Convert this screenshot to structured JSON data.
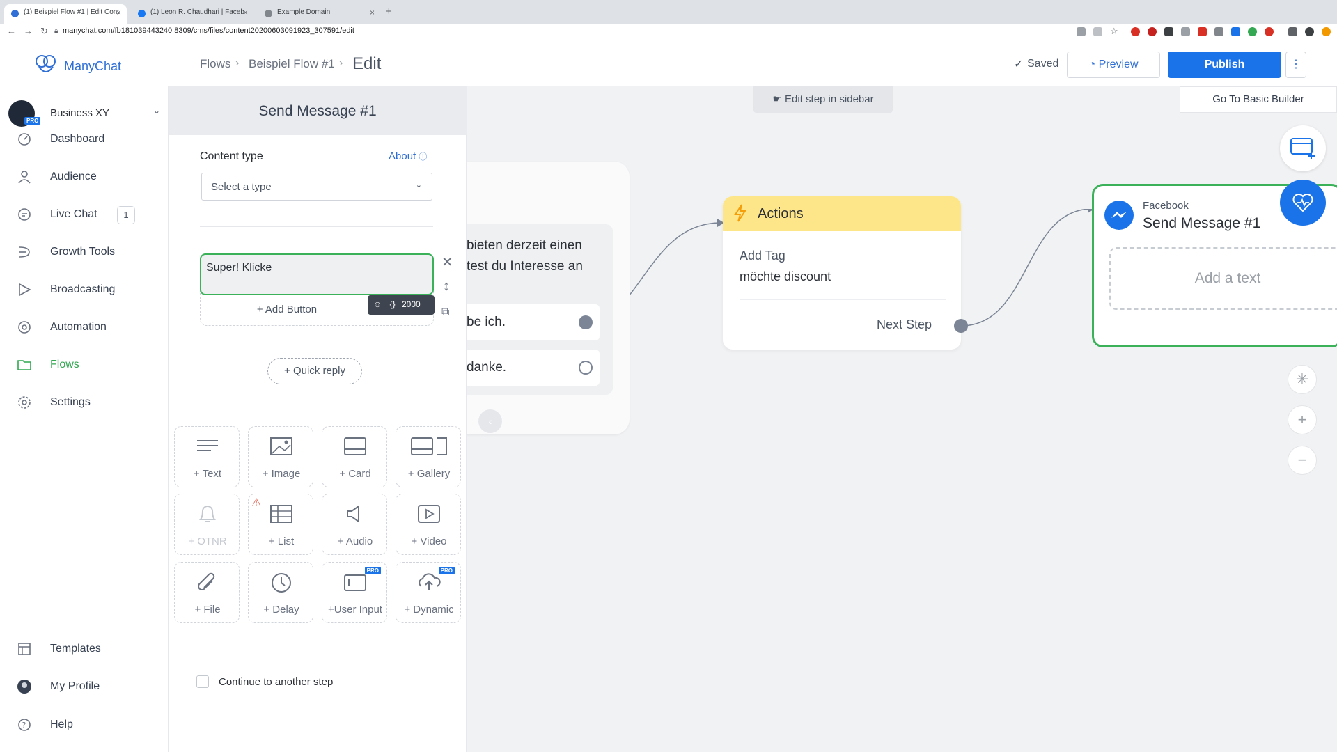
{
  "browser": {
    "tabs": [
      {
        "title": "(1) Beispiel Flow #1 | Edit Cont"
      },
      {
        "title": "(1) Leon R. Chaudhari | Faceb"
      },
      {
        "title": "Example Domain"
      }
    ],
    "url": "manychat.com/fb181039443240 8309/cms/files/content20200603091923_307591/edit"
  },
  "header": {
    "logo": "ManyChat",
    "breadcrumb": [
      "Flows",
      "Beispiel Flow #1"
    ],
    "current": "Edit",
    "saved": "Saved",
    "preview": "Preview",
    "publish": "Publish"
  },
  "sidebar": {
    "business": {
      "name": "Business XY",
      "pro": "PRO"
    },
    "items": [
      {
        "label": "Dashboard",
        "icon": "dashboard-icon"
      },
      {
        "label": "Audience",
        "icon": "audience-icon"
      },
      {
        "label": "Live Chat",
        "icon": "chat-icon",
        "badge": "1"
      },
      {
        "label": "Growth Tools",
        "icon": "growth-tools-icon"
      },
      {
        "label": "Broadcasting",
        "icon": "broadcast-icon"
      },
      {
        "label": "Automation",
        "icon": "automation-icon"
      },
      {
        "label": "Flows",
        "icon": "folder-icon",
        "active": true
      },
      {
        "label": "Settings",
        "icon": "gear-icon"
      }
    ],
    "bottom": [
      {
        "label": "Templates",
        "icon": "templates-icon"
      },
      {
        "label": "My Profile",
        "icon": "avatar-icon"
      },
      {
        "label": "Help",
        "icon": "help-icon"
      }
    ]
  },
  "panel": {
    "title": "Send Message #1",
    "content_type_label": "Content type",
    "about": "About",
    "select_placeholder": "Select a type",
    "text_value": "Super! Klicke",
    "char_limit": "2000",
    "add_button": "+ Add Button",
    "quick_reply": "+ Quick reply",
    "tiles": [
      {
        "label": "+ Text",
        "icon": "text-icon"
      },
      {
        "label": "+ Image",
        "icon": "image-icon"
      },
      {
        "label": "+ Card",
        "icon": "card-icon"
      },
      {
        "label": "+ Gallery",
        "icon": "gallery-icon"
      },
      {
        "label": "+ OTNR",
        "icon": "bell-icon",
        "disabled": true
      },
      {
        "label": "+ List",
        "icon": "list-icon",
        "warning": true
      },
      {
        "label": "+ Audio",
        "icon": "audio-icon"
      },
      {
        "label": "+ Video",
        "icon": "video-icon"
      },
      {
        "label": "+ File",
        "icon": "paperclip-icon"
      },
      {
        "label": "+ Delay",
        "icon": "clock-icon"
      },
      {
        "label": "+User Input",
        "icon": "user-input-icon",
        "pro": "PRO"
      },
      {
        "label": "+ Dynamic",
        "icon": "dynamic-icon",
        "pro": "PRO"
      }
    ],
    "continue_label": "Continue to another step"
  },
  "canvas": {
    "edit_hint": "Edit step in sidebar",
    "basic_builder": "Go To Basic Builder",
    "left_node": {
      "text": "bieten derzeit einen test du Interesse an",
      "options": [
        "be ich.",
        "danke."
      ]
    },
    "actions_node": {
      "title": "Actions",
      "action_label": "Add Tag",
      "action_value": "möchte discount",
      "next_step": "Next Step"
    },
    "message_node": {
      "channel": "Facebook",
      "title": "Send Message #1",
      "add_text": "Add a text"
    }
  },
  "colors": {
    "accent": "#1a73e8",
    "flows_active": "#2fa84f",
    "actions_header": "#fde68a",
    "selected_border": "#3bb25a"
  }
}
